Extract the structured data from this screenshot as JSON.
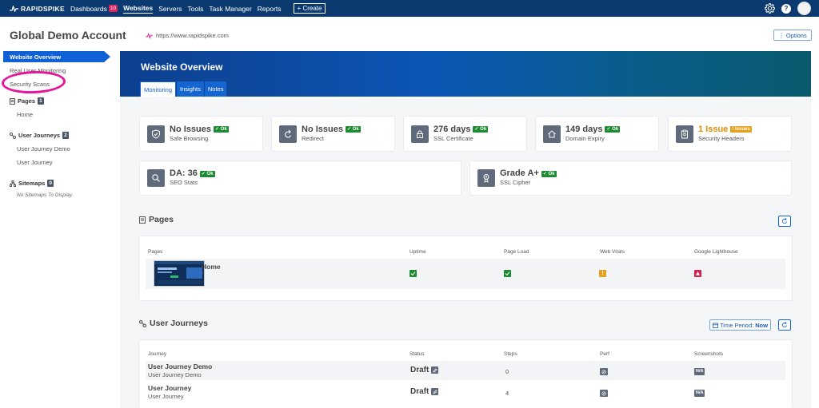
{
  "nav": {
    "brand": "RAPIDSPIKE",
    "links": [
      {
        "label": "Dashboards",
        "badge": "10"
      },
      {
        "label": "Websites"
      },
      {
        "label": "Servers"
      },
      {
        "label": "Tools"
      },
      {
        "label": "Task Manager"
      },
      {
        "label": "Reports"
      }
    ],
    "create_label": "+ Create"
  },
  "account": {
    "title": "Global Demo Account",
    "url": "https://www.rapidspike.com",
    "options_label": "⋮ Options"
  },
  "sidebar": {
    "active_item": "Website Overview",
    "items": [
      "Real User Monitoring",
      "Security Scans"
    ],
    "pages": {
      "label": "Pages",
      "count": "1",
      "items": [
        "Home"
      ]
    },
    "journeys": {
      "label": "User Journeys",
      "count": "2",
      "items": [
        "User Journey Demo",
        "User Journey"
      ]
    },
    "sitemaps": {
      "label": "Sitemaps",
      "count": "0",
      "empty": "No Sitemaps To Display."
    }
  },
  "overview": {
    "title": "Website Overview",
    "tabs": [
      "Monitoring",
      "Insights",
      "Notes"
    ],
    "cards": [
      {
        "value": "No Issues",
        "badge": "✓ Ok",
        "label": "Safe Browsing",
        "icon": "shield-icon"
      },
      {
        "value": "No Issues",
        "badge": "✓ Ok",
        "label": "Redirect",
        "icon": "redirect-icon"
      },
      {
        "value": "276 days",
        "badge": "✓ Ok",
        "label": "SSL Certificate",
        "icon": "lock-icon"
      },
      {
        "value": "149 days",
        "badge": "✓ Ok",
        "label": "Domain Expiry",
        "icon": "home-icon"
      },
      {
        "value": "1 Issue",
        "badge": "! Issues",
        "label": "Security Headers",
        "icon": "clipboard-icon"
      },
      {
        "value": "DA: 36",
        "badge": "✓ Ok",
        "label": "SEO Stats",
        "icon": "search-icon"
      },
      {
        "value": "Grade A+",
        "badge": "✓ Ok",
        "label": "SSL Cipher",
        "icon": "award-icon"
      }
    ]
  },
  "pages_section": {
    "title": "Pages",
    "columns": [
      "Pages",
      "Uptime",
      "Page Load",
      "Web Vitals",
      "Google Lighthouse"
    ],
    "rows": [
      {
        "name": "Home",
        "path": "/",
        "uptime": "ok",
        "page_load": "ok",
        "web_vitals": "warning",
        "lighthouse": "error"
      }
    ]
  },
  "journeys_section": {
    "title": "User Journeys",
    "time_period_label": "Time Period:",
    "time_period_value": "Now",
    "columns": [
      "Journey",
      "Status",
      "Steps",
      "Perf",
      "Screenshots"
    ],
    "rows": [
      {
        "name": "User Journey Demo",
        "sub": "User Journey Demo",
        "status": "Draft",
        "steps": "0",
        "screenshots": "N/A"
      },
      {
        "name": "User Journey",
        "sub": "User Journey",
        "status": "Draft",
        "steps": "4",
        "screenshots": "N/A"
      }
    ]
  },
  "colors": {
    "nav": "#0a3a70",
    "accent": "#1060d8",
    "ok": "#1e8a33",
    "warning": "#e8a11a",
    "error": "#d0244f",
    "highlight": "#e6149a"
  }
}
